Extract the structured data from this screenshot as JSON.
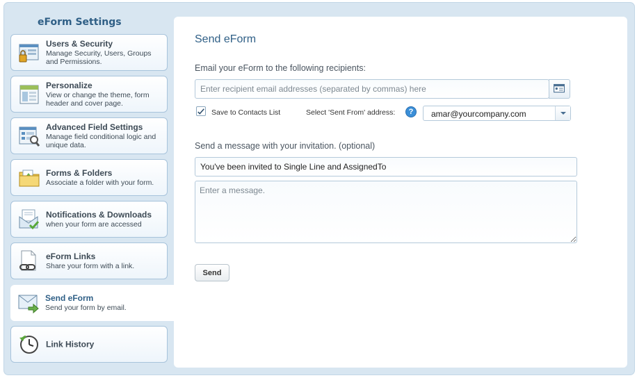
{
  "sidebar": {
    "title": "eForm Settings",
    "items": [
      {
        "title": "Users & Security",
        "desc": "Manage Security, Users, Groups and Permissions."
      },
      {
        "title": "Personalize",
        "desc": "View or change the theme, form header and cover page."
      },
      {
        "title": "Advanced Field Settings",
        "desc": "Manage field conditional logic and unique data."
      },
      {
        "title": "Forms & Folders",
        "desc": "Associate a folder with your form."
      },
      {
        "title": "Notifications & Downloads",
        "desc": "when your form are accessed"
      },
      {
        "title": "eForm Links",
        "desc": "Share your form with a link."
      },
      {
        "title": "Send eForm",
        "desc": "Send your form by email.",
        "active": true
      },
      {
        "title": "Link History",
        "desc": ""
      }
    ]
  },
  "main": {
    "title": "Send eForm",
    "recipients_label": "Email your eForm to the following recipients:",
    "recipients_placeholder": "Enter recipient email addresses (separated by commas) here",
    "recipients_value": "",
    "save_contacts_label": "Save to Contacts List",
    "save_contacts_checked": true,
    "sent_from_label": "Select 'Sent From' address:",
    "sent_from_value": "amar@yourcompany.com",
    "message_label": "Send a message with your invitation. (optional)",
    "subject_value": "You've been invited to Single Line and AssignedTo",
    "message_placeholder": "Enter a message.",
    "send_button": "Send"
  },
  "colors": {
    "frame_bg": "#d8e6f1",
    "accent": "#2f5f86",
    "help_icon": "#3b8fd8"
  },
  "icons": {
    "users_security": "users-lock-icon",
    "personalize": "layout-icon",
    "advanced_fields": "field-settings-icon",
    "forms_folders": "folder-icon",
    "notifications": "envelope-check-icon",
    "eform_links": "document-link-icon",
    "send_eform": "envelope-arrow-icon",
    "link_history": "clock-history-icon",
    "contacts": "contact-card-icon",
    "help": "question-icon",
    "dropdown": "chevron-down-icon"
  }
}
